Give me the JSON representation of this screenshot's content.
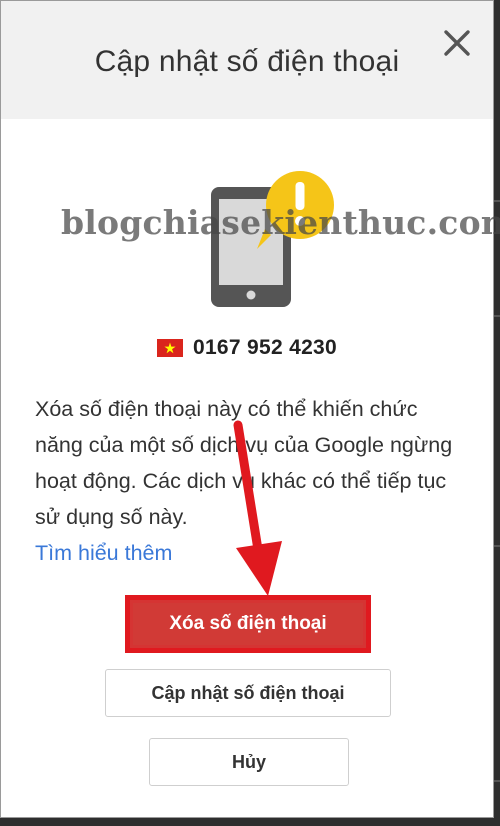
{
  "dialog": {
    "title": "Cập nhật số điện thoại",
    "close_icon": "close-icon",
    "watermark": "blogchiasekienthuc.com",
    "phone": {
      "flag_icon": "vietnam-flag-icon",
      "number": "0167 952 4230"
    },
    "description": "Xóa số điện thoại này có thể khiến chức năng của một số dịch vụ của Google ngừng hoạt động. Các dịch vụ khác có thể tiếp tục sử dụng số này.",
    "learn_more": "Tìm hiểu thêm",
    "buttons": {
      "delete": "Xóa số điện thoại",
      "update": "Cập nhật số điện thoại",
      "cancel": "Hủy"
    }
  },
  "colors": {
    "accent_red": "#e0191f",
    "button_red": "#d13a36",
    "link_blue": "#3a78d8",
    "warning_yellow": "#f5c518"
  }
}
